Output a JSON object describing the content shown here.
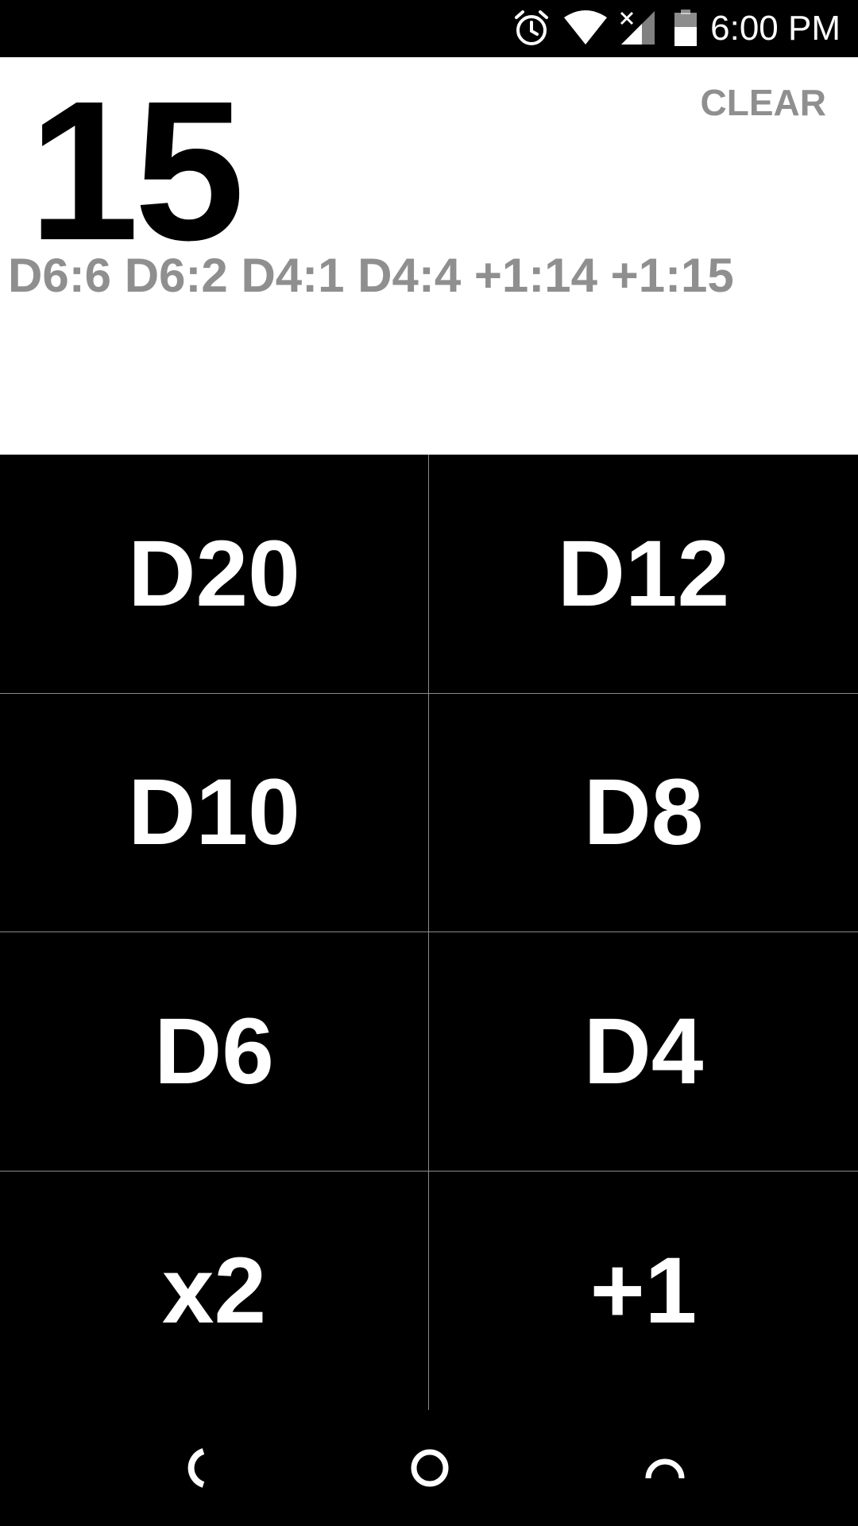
{
  "status_bar": {
    "time": "6:00 PM",
    "icons": [
      "alarm-icon",
      "wifi-icon",
      "cell-signal-no-service-icon",
      "battery-icon"
    ]
  },
  "result": {
    "total": "15",
    "clear_label": "CLEAR",
    "history": "D6:6 D6:2 D4:1 D4:4 +1:14 +1:15"
  },
  "dice_buttons": [
    "D20",
    "D12",
    "D10",
    "D8",
    "D6",
    "D4",
    "x2",
    "+1"
  ],
  "nav_bar": {
    "icons": [
      "back-icon",
      "home-icon",
      "recents-icon"
    ]
  },
  "colors": {
    "background": "#000000",
    "panel": "#ffffff",
    "muted_text": "#8f8f8f",
    "divider": "#8a8a8a"
  }
}
